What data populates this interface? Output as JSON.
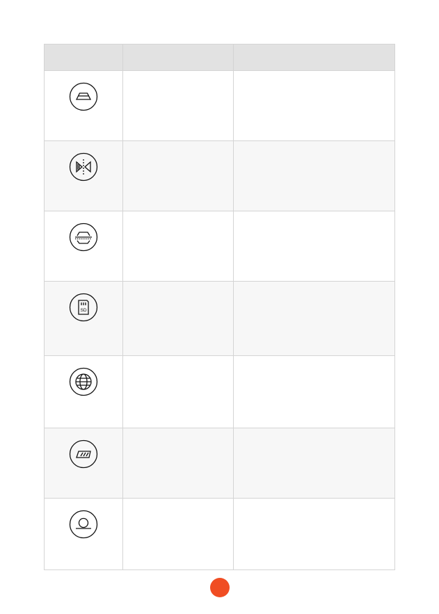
{
  "table": {
    "header": [
      "",
      "",
      ""
    ],
    "rows": [
      {
        "icon": "trapezoid-icon",
        "name": "",
        "description": ""
      },
      {
        "icon": "mirror-flip-icon",
        "name": "",
        "description": ""
      },
      {
        "icon": "horizon-line-icon",
        "name": "",
        "description": ""
      },
      {
        "icon": "sd-card-icon",
        "name": "",
        "description": "",
        "icon_text": "SD"
      },
      {
        "icon": "globe-icon",
        "name": "",
        "description": ""
      },
      {
        "icon": "hatched-plate-icon",
        "name": "",
        "description": ""
      },
      {
        "icon": "ring-base-icon",
        "name": "",
        "description": ""
      }
    ]
  },
  "page_marker_color": "#f04d23"
}
